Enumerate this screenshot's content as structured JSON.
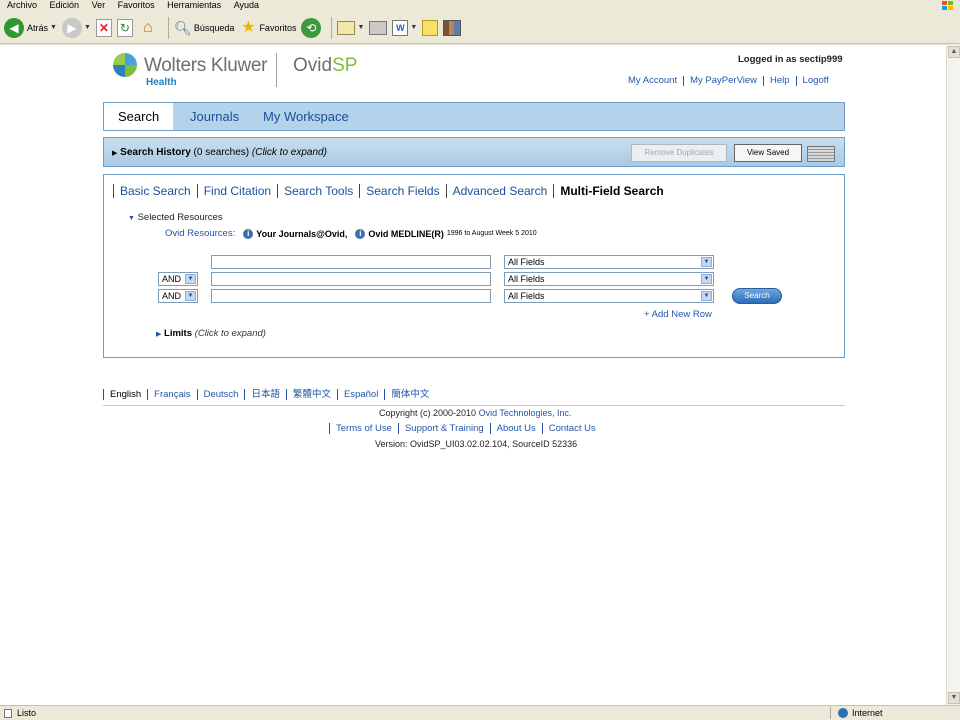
{
  "browser": {
    "menu": [
      "Archivo",
      "Edición",
      "Ver",
      "Favoritos",
      "Herramientas",
      "Ayuda"
    ],
    "toolbar": {
      "back": "Atrás",
      "search": "Búsqueda",
      "favorites": "Favoritos"
    },
    "status": {
      "left": "Listo",
      "zone": "Internet"
    }
  },
  "header": {
    "brand": "Wolters Kluwer",
    "brand_sub": "Health",
    "product_prefix": "Ovid",
    "product_suffix": "SP",
    "logged_in": "Logged in as sectip999",
    "links": [
      "My Account",
      "My PayPerView",
      "Help",
      "Logoff"
    ]
  },
  "nav": {
    "tabs": [
      "Search",
      "Journals",
      "My Workspace"
    ]
  },
  "history": {
    "label": "Search History",
    "count": "(0 searches)",
    "hint": "(Click to expand)",
    "remove_duplicates": "Remove Duplicates",
    "view_saved": "View Saved"
  },
  "search": {
    "subtabs": [
      "Basic Search",
      "Find Citation",
      "Search Tools",
      "Search Fields",
      "Advanced Search",
      "Multi-Field Search"
    ],
    "selected_resources": "Selected Resources",
    "ovid_resources_label": "Ovid Resources:",
    "resources": [
      {
        "name": "Your Journals@Ovid,",
        "date": ""
      },
      {
        "name": "Ovid MEDLINE(R)",
        "date": "1996 to August Week 5 2010"
      }
    ],
    "rows": [
      {
        "bool": "",
        "term": "",
        "field": "All Fields"
      },
      {
        "bool": "AND",
        "term": "",
        "field": "All Fields"
      },
      {
        "bool": "AND",
        "term": "",
        "field": "All Fields"
      }
    ],
    "search_button": "Search",
    "add_row": "+ Add New Row",
    "limits_label": "Limits",
    "limits_hint": "(Click to expand)"
  },
  "footer": {
    "languages": [
      "English",
      "Français",
      "Deutsch",
      "日本語",
      "繁體中文",
      "Español",
      "簡体中文"
    ],
    "copyright_prefix": "Copyright (c) 2000-2010",
    "copyright_link": "Ovid Technologies, Inc.",
    "links": [
      "Terms of Use",
      "Support & Training",
      "About Us",
      "Contact Us"
    ],
    "version": "Version: OvidSP_UI03.02.02.104, SourceID 52336"
  }
}
